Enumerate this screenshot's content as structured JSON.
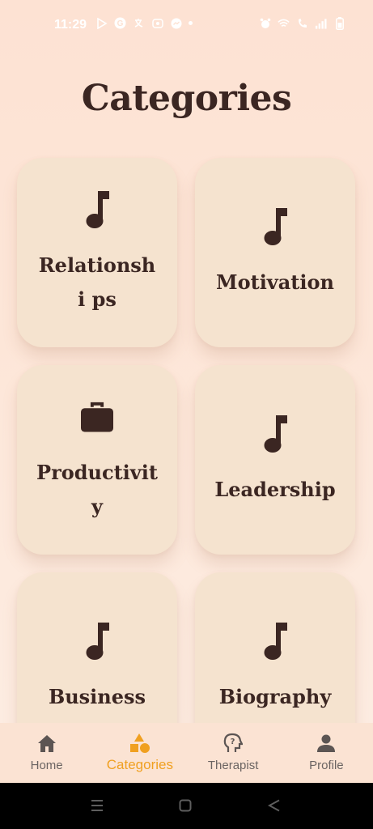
{
  "status_bar": {
    "time": "11:29"
  },
  "page": {
    "title": "Categories"
  },
  "categories": [
    {
      "label": "Relationshi ps",
      "icon": "music-note-icon"
    },
    {
      "label": "Motivation",
      "icon": "music-note-icon"
    },
    {
      "label": "Productivit y",
      "icon": "briefcase-icon"
    },
    {
      "label": "Leadership",
      "icon": "music-note-icon"
    },
    {
      "label": "Business",
      "icon": "music-note-icon"
    },
    {
      "label": "Biography",
      "icon": "music-note-icon"
    }
  ],
  "bottom_nav": {
    "items": [
      {
        "label": "Home",
        "icon": "home-icon"
      },
      {
        "label": "Categories",
        "icon": "shapes-icon",
        "active": true
      },
      {
        "label": "Therapist",
        "icon": "head-question-icon"
      },
      {
        "label": "Profile",
        "icon": "person-icon"
      }
    ]
  },
  "colors": {
    "accent": "#f0a020",
    "text_dark": "#3b2622",
    "card_bg": "#f5e3cf",
    "page_bg": "#fde2d3"
  }
}
